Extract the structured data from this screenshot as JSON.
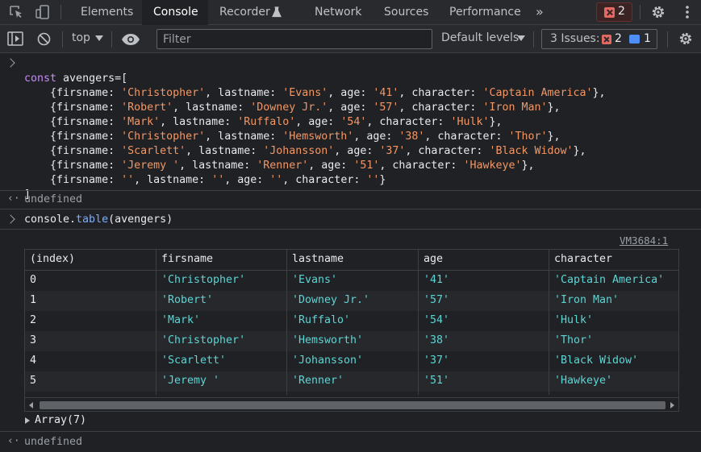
{
  "tabs": {
    "items": [
      "Elements",
      "Console",
      "Recorder",
      "Network",
      "Sources",
      "Performance"
    ],
    "more_label": "»",
    "active": "Console"
  },
  "error_badge": {
    "count": "2"
  },
  "toolbar": {
    "context": "top",
    "filter_placeholder": "Filter",
    "default_levels": "Default levels",
    "issues_label": "3 Issues:",
    "issues_error_count": "2",
    "issues_info_count": "1"
  },
  "console": {
    "input1": [
      {
        "parts": [
          {
            "t": "const ",
            "c": "kw"
          },
          {
            "t": "avengers=[",
            "c": "def"
          }
        ]
      },
      {
        "parts": [
          {
            "t": "    {firsname: ",
            "c": "def"
          },
          {
            "t": "'Christopher'",
            "c": "str"
          },
          {
            "t": ", lastname: ",
            "c": "def"
          },
          {
            "t": "'Evans'",
            "c": "str"
          },
          {
            "t": ", age: ",
            "c": "def"
          },
          {
            "t": "'41'",
            "c": "str"
          },
          {
            "t": ", character: ",
            "c": "def"
          },
          {
            "t": "'Captain America'",
            "c": "str"
          },
          {
            "t": "},",
            "c": "def"
          }
        ]
      },
      {
        "parts": [
          {
            "t": "    {firsname: ",
            "c": "def"
          },
          {
            "t": "'Robert'",
            "c": "str"
          },
          {
            "t": ", lastname: ",
            "c": "def"
          },
          {
            "t": "'Downey Jr.'",
            "c": "str"
          },
          {
            "t": ", age: ",
            "c": "def"
          },
          {
            "t": "'57'",
            "c": "str"
          },
          {
            "t": ", character: ",
            "c": "def"
          },
          {
            "t": "'Iron Man'",
            "c": "str"
          },
          {
            "t": "},",
            "c": "def"
          }
        ]
      },
      {
        "parts": [
          {
            "t": "    {firsname: ",
            "c": "def"
          },
          {
            "t": "'Mark'",
            "c": "str"
          },
          {
            "t": ", lastname: ",
            "c": "def"
          },
          {
            "t": "'Ruffalo'",
            "c": "str"
          },
          {
            "t": ", age: ",
            "c": "def"
          },
          {
            "t": "'54'",
            "c": "str"
          },
          {
            "t": ", character: ",
            "c": "def"
          },
          {
            "t": "'Hulk'",
            "c": "str"
          },
          {
            "t": "},",
            "c": "def"
          }
        ]
      },
      {
        "parts": [
          {
            "t": "    {firsname: ",
            "c": "def"
          },
          {
            "t": "'Christopher'",
            "c": "str"
          },
          {
            "t": ", lastname: ",
            "c": "def"
          },
          {
            "t": "'Hemsworth'",
            "c": "str"
          },
          {
            "t": ", age: ",
            "c": "def"
          },
          {
            "t": "'38'",
            "c": "str"
          },
          {
            "t": ", character: ",
            "c": "def"
          },
          {
            "t": "'Thor'",
            "c": "str"
          },
          {
            "t": "},",
            "c": "def"
          }
        ]
      },
      {
        "parts": [
          {
            "t": "    {firsname: ",
            "c": "def"
          },
          {
            "t": "'Scarlett'",
            "c": "str"
          },
          {
            "t": ", lastname: ",
            "c": "def"
          },
          {
            "t": "'Johansson'",
            "c": "str"
          },
          {
            "t": ", age: ",
            "c": "def"
          },
          {
            "t": "'37'",
            "c": "str"
          },
          {
            "t": ", character: ",
            "c": "def"
          },
          {
            "t": "'Black Widow'",
            "c": "str"
          },
          {
            "t": "},",
            "c": "def"
          }
        ]
      },
      {
        "parts": [
          {
            "t": "    {firsname: ",
            "c": "def"
          },
          {
            "t": "'Jeremy '",
            "c": "str"
          },
          {
            "t": ", lastname: ",
            "c": "def"
          },
          {
            "t": "'Renner'",
            "c": "str"
          },
          {
            "t": ", age: ",
            "c": "def"
          },
          {
            "t": "'51'",
            "c": "str"
          },
          {
            "t": ", character: ",
            "c": "def"
          },
          {
            "t": "'Hawkeye'",
            "c": "str"
          },
          {
            "t": "},",
            "c": "def"
          }
        ]
      },
      {
        "parts": [
          {
            "t": "    {firsname: ",
            "c": "def"
          },
          {
            "t": "''",
            "c": "str"
          },
          {
            "t": ", lastname: ",
            "c": "def"
          },
          {
            "t": "''",
            "c": "str"
          },
          {
            "t": ", age: ",
            "c": "def"
          },
          {
            "t": "''",
            "c": "str"
          },
          {
            "t": ", character: ",
            "c": "def"
          },
          {
            "t": "''",
            "c": "str"
          },
          {
            "t": "}",
            "c": "def"
          }
        ]
      },
      {
        "parts": [
          {
            "t": "]",
            "c": "def"
          }
        ]
      }
    ],
    "result1": "undefined",
    "input2_obj": "console.",
    "input2_fn": "table",
    "input2_args": "(avengers)",
    "source_link": "VM3684:1",
    "array_label": "Array(7)",
    "result2": "undefined"
  },
  "table": {
    "headers": [
      "(index)",
      "firsname",
      "lastname",
      "age",
      "character"
    ],
    "rows": [
      [
        "0",
        "'Christopher'",
        "'Evans'",
        "'41'",
        "'Captain America'"
      ],
      [
        "1",
        "'Robert'",
        "'Downey Jr.'",
        "'57'",
        "'Iron Man'"
      ],
      [
        "2",
        "'Mark'",
        "'Ruffalo'",
        "'54'",
        "'Hulk'"
      ],
      [
        "3",
        "'Christopher'",
        "'Hemsworth'",
        "'38'",
        "'Thor'"
      ],
      [
        "4",
        "'Scarlett'",
        "'Johansson'",
        "'37'",
        "'Black Widow'"
      ],
      [
        "5",
        "'Jeremy '",
        "'Renner'",
        "'51'",
        "'Hawkeye'"
      ]
    ]
  },
  "colors": {
    "panel_bg": "#202124",
    "toolbar_bg": "#292a2d",
    "keyword": "#c58af9",
    "string": "#f29766",
    "table_string": "#5cd5d5",
    "error": "#e46962",
    "info": "#4d8ef7"
  },
  "icons": [
    "inspect-element-icon",
    "device-toolbar-icon",
    "recorder-flask-icon",
    "settings-gear-icon",
    "more-vertical-icon",
    "sidebar-toggle-icon",
    "clear-console-icon",
    "live-expression-eye-icon",
    "error-x-icon",
    "message-icon"
  ]
}
